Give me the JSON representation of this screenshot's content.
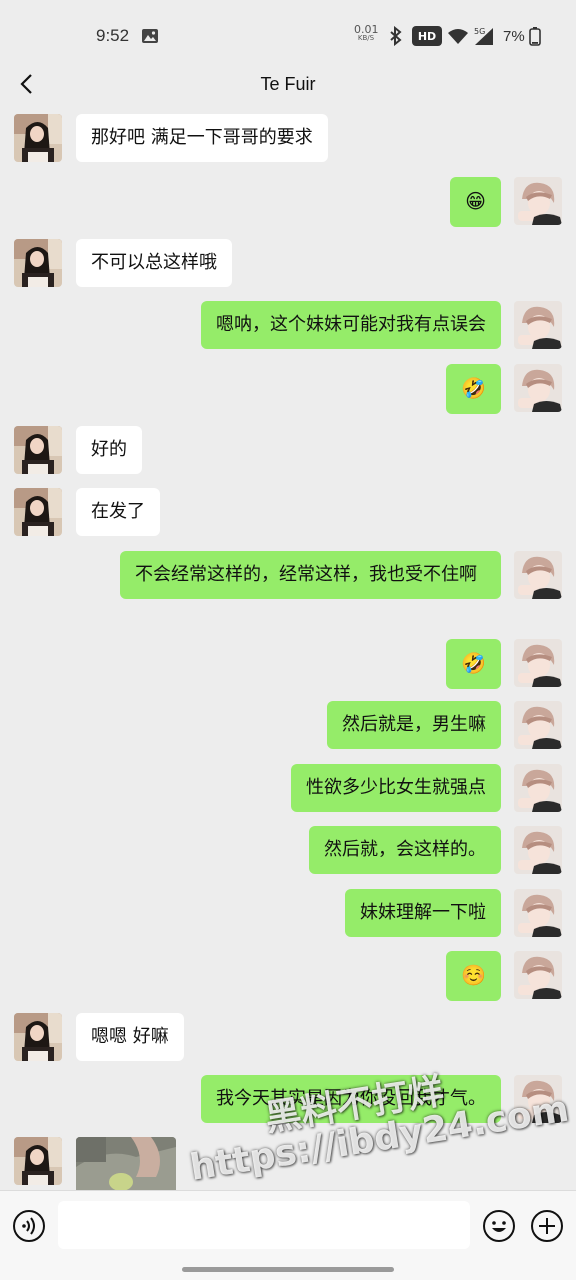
{
  "status_bar": {
    "time": "9:52",
    "speed_value": "0.01",
    "speed_unit": "KB/S",
    "hd": "HD",
    "network": "5G",
    "battery": "7%"
  },
  "header": {
    "title": "Te Fuir"
  },
  "messages": [
    {
      "side": "in",
      "text": "那好吧 满足一下哥哥的要求"
    },
    {
      "side": "out",
      "emoji": "😁",
      "icon": "grinning-face-emoji"
    },
    {
      "side": "in",
      "text": "不可以总这样哦"
    },
    {
      "side": "out",
      "text": "嗯呐，这个妹妹可能对我有点误会"
    },
    {
      "side": "out",
      "emoji": "🤣",
      "icon": "rolling-laughing-emoji"
    },
    {
      "side": "in",
      "text": "好的"
    },
    {
      "side": "in",
      "text": "在发了"
    },
    {
      "side": "out",
      "text": "不会经常这样的，经常这样，我也受不住啊"
    },
    {
      "side": "out",
      "emoji": "🤣",
      "icon": "rolling-laughing-emoji"
    },
    {
      "side": "out",
      "text": "然后就是，男生嘛"
    },
    {
      "side": "out",
      "text": "性欲多少比女生就强点"
    },
    {
      "side": "out",
      "text": "然后就，会这样的。"
    },
    {
      "side": "out",
      "text": "妹妹理解一下啦"
    },
    {
      "side": "out",
      "emoji": "☺️",
      "icon": "smiling-face-emoji"
    },
    {
      "side": "in",
      "text": "嗯嗯 好嘛"
    },
    {
      "side": "out",
      "text": "我今天其实是因为你没回我才气。"
    },
    {
      "side": "in",
      "type": "image",
      "icon": "photo-thumbnail"
    }
  ],
  "watermark": {
    "line1": "黑料不打烊",
    "line2": "https://ibdy24.com"
  },
  "input_bar": {
    "text_value": "",
    "icons": [
      "voice-icon",
      "emoji-icon",
      "plus-icon"
    ]
  },
  "colors": {
    "background": "#ededed",
    "incoming_bubble": "#ffffff",
    "outgoing_bubble": "#95ec69"
  }
}
